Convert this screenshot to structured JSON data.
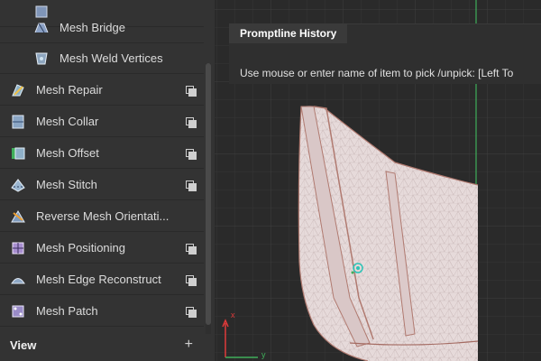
{
  "sidebar": {
    "items": [
      {
        "label": "",
        "kind": "sub",
        "icon": "mesh-partial-icon",
        "has_copy": false
      },
      {
        "label": "Mesh Bridge",
        "kind": "sub",
        "icon": "mesh-bridge-icon",
        "has_copy": false
      },
      {
        "label": "Mesh Weld Vertices",
        "kind": "sub",
        "icon": "mesh-weld-icon",
        "has_copy": false
      },
      {
        "label": "Mesh Repair",
        "kind": "top",
        "icon": "mesh-repair-icon",
        "has_copy": true
      },
      {
        "label": "Mesh Collar",
        "kind": "top",
        "icon": "mesh-collar-icon",
        "has_copy": true
      },
      {
        "label": "Mesh Offset",
        "kind": "top",
        "icon": "mesh-offset-icon",
        "has_copy": true
      },
      {
        "label": "Mesh Stitch",
        "kind": "top",
        "icon": "mesh-stitch-icon",
        "has_copy": true
      },
      {
        "label": "Reverse Mesh Orientati...",
        "kind": "top",
        "icon": "reverse-mesh-icon",
        "has_copy": false
      },
      {
        "label": "Mesh Positioning",
        "kind": "top",
        "icon": "mesh-positioning-icon",
        "has_copy": true
      },
      {
        "label": "Mesh Edge Reconstruct",
        "kind": "top",
        "icon": "mesh-edge-icon",
        "has_copy": true
      },
      {
        "label": "Mesh Patch",
        "kind": "top",
        "icon": "mesh-patch-icon",
        "has_copy": true
      }
    ],
    "section": {
      "title": "View",
      "action": "+"
    }
  },
  "prompt": {
    "tab": "Promptline History",
    "message": "Use mouse or enter name of item to pick /unpick: [Left To"
  },
  "viewport": {
    "axis_x": "x",
    "axis_y": "y"
  },
  "colors": {
    "accent_green": "#3fae5a",
    "axis_red": "#e03a3a",
    "mesh_fill": "#e9dede",
    "mesh_edge": "#b07a70"
  }
}
